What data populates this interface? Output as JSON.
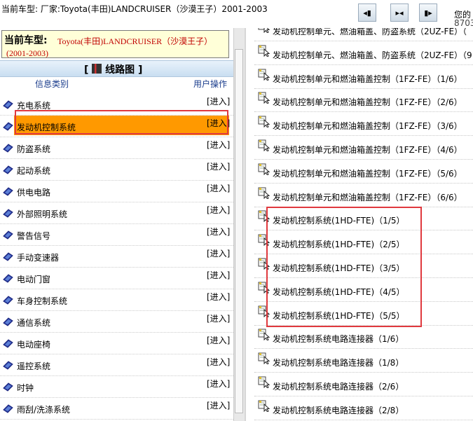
{
  "topbar": {
    "title": "当前车型:  厂家:Toyota(丰田)LANDCRUISER（沙漠王子）2001-2003",
    "nav_buttons": [
      "prev-page",
      "fit-page",
      "next-page"
    ],
    "user_line1": "您的",
    "user_line2": "8703"
  },
  "vehicle": {
    "label": "当前车型:",
    "name": "Toyota(丰田)LANDCRUISER（沙漠王子）",
    "years": "(2001-2003)"
  },
  "section": {
    "title": "线路图"
  },
  "columns": {
    "category": "信息类别",
    "action": "用户操作"
  },
  "categories": [
    {
      "label": "充电系统",
      "action": "[进入]"
    },
    {
      "label": "发动机控制系统",
      "action": "[进入]",
      "selected": true
    },
    {
      "label": "防盗系统",
      "action": "[进入]"
    },
    {
      "label": "起动系统",
      "action": "[进入]"
    },
    {
      "label": "供电电路",
      "action": "[进入]"
    },
    {
      "label": "外部照明系统",
      "action": "[进入]"
    },
    {
      "label": "警告信号",
      "action": "[进入]"
    },
    {
      "label": "手动变速器",
      "action": "[进入]"
    },
    {
      "label": "电动门窗",
      "action": "[进入]"
    },
    {
      "label": "车身控制系统",
      "action": "[进入]"
    },
    {
      "label": "通信系统",
      "action": "[进入]"
    },
    {
      "label": "电动座椅",
      "action": "[进入]"
    },
    {
      "label": "遥控系统",
      "action": "[进入]"
    },
    {
      "label": "时钟",
      "action": "[进入]"
    },
    {
      "label": "雨刮/洗涤系统",
      "action": "[进入]"
    }
  ],
  "diagrams": [
    {
      "label": "发动机控制单元、燃油箱盖、防盗系统（2UZ-FE）（"
    },
    {
      "label": "发动机控制单元、燃油箱盖、防盗系统（2UZ-FE）（9"
    },
    {
      "label": "发动机控制单元和燃油箱盖控制（1FZ-FE）（1/6）"
    },
    {
      "label": "发动机控制单元和燃油箱盖控制（1FZ-FE）（2/6）"
    },
    {
      "label": "发动机控制单元和燃油箱盖控制（1FZ-FE）（3/6）"
    },
    {
      "label": "发动机控制单元和燃油箱盖控制（1FZ-FE）（4/6）"
    },
    {
      "label": "发动机控制单元和燃油箱盖控制（1FZ-FE）（5/6）"
    },
    {
      "label": "发动机控制单元和燃油箱盖控制（1FZ-FE）（6/6）"
    },
    {
      "label": "发动机控制系统(1HD-FTE)（1/5）"
    },
    {
      "label": "发动机控制系统(1HD-FTE)（2/5）"
    },
    {
      "label": "发动机控制系统(1HD-FTE)（3/5）"
    },
    {
      "label": "发动机控制系统(1HD-FTE)（4/5）"
    },
    {
      "label": "发动机控制系统(1HD-FTE)（5/5）"
    },
    {
      "label": "发动机控制系统电路连接器（1/6）"
    },
    {
      "label": "发动机控制系统电路连接器（1/8）"
    },
    {
      "label": "发动机控制系统电路连接器（2/6）"
    },
    {
      "label": "发动机控制系统电路连接器（2/8）"
    }
  ],
  "colors": {
    "selected_bg": "#ff9900",
    "vehicle_text": "#c00000",
    "column_header": "#1a3c8c",
    "highlight_box": "#e0393e"
  }
}
